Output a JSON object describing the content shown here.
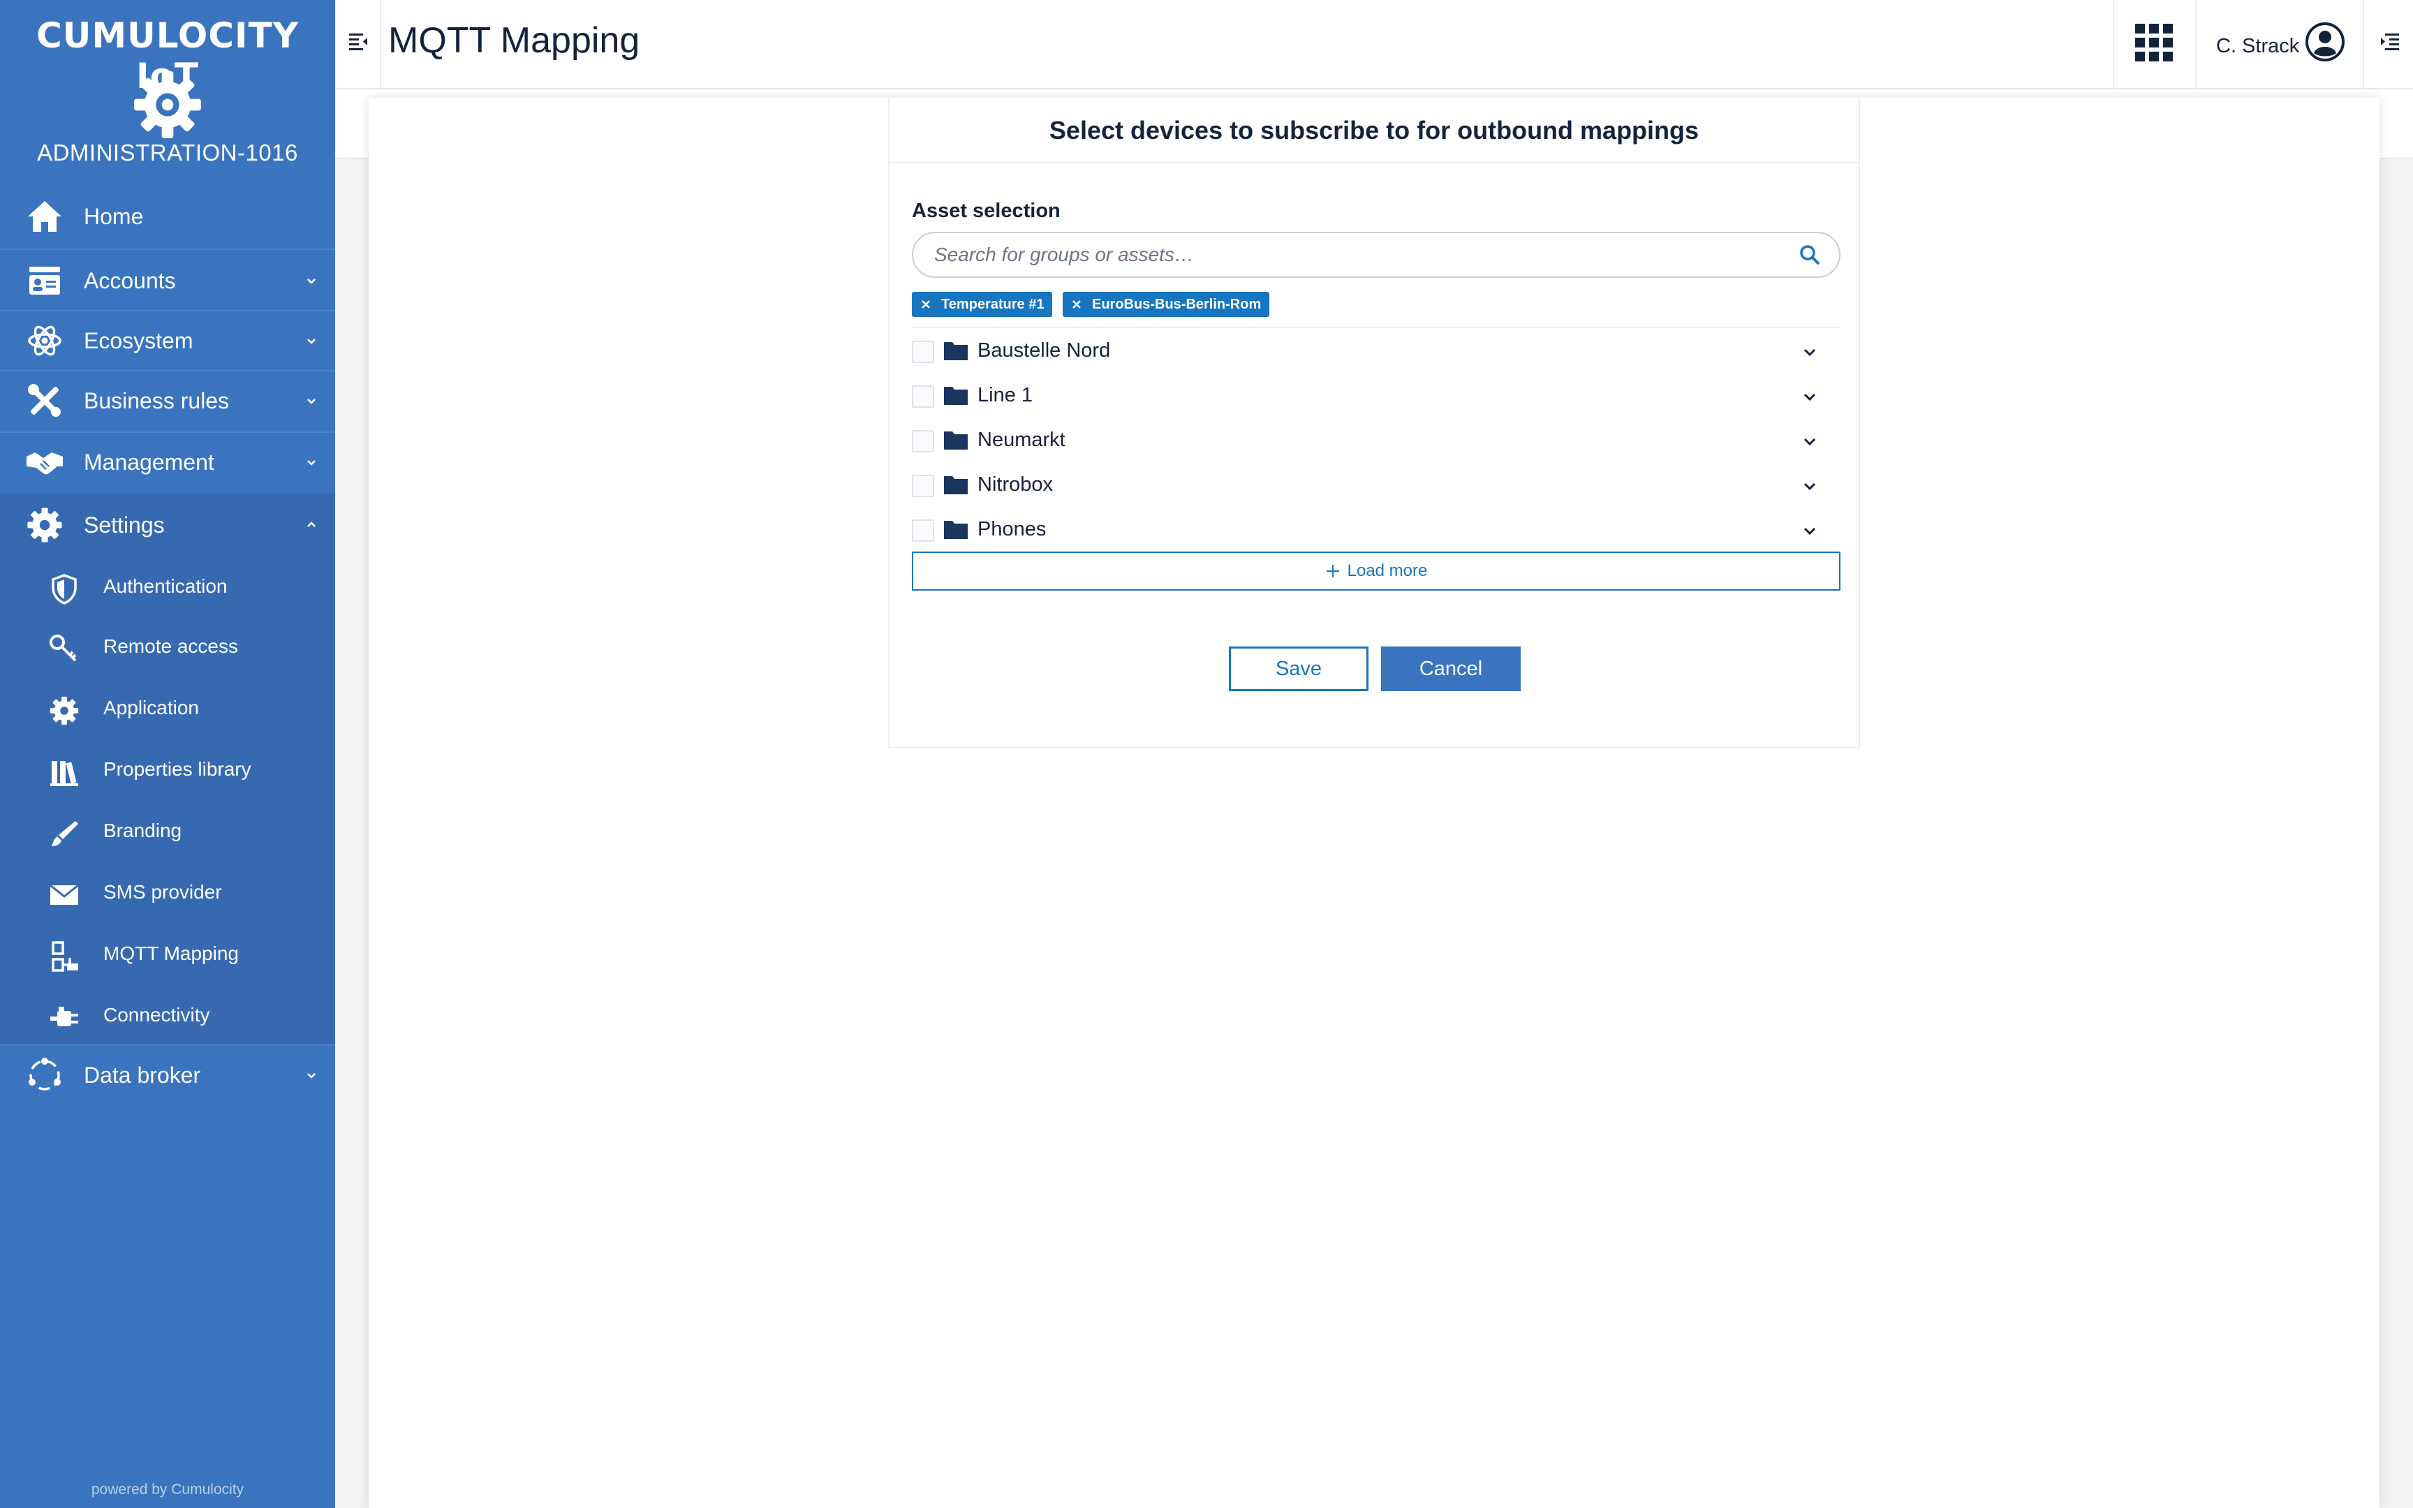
{
  "sidebar": {
    "brand": "CUMULOCITY IoT",
    "tenant": "ADMINISTRATION-1016",
    "items": [
      {
        "label": "Home",
        "icon": "home-icon"
      },
      {
        "label": "Accounts",
        "icon": "accounts-icon"
      },
      {
        "label": "Ecosystem",
        "icon": "atom-icon"
      },
      {
        "label": "Business rules",
        "icon": "tools-icon"
      },
      {
        "label": "Management",
        "icon": "handshake-icon"
      },
      {
        "label": "Settings",
        "icon": "gear-icon"
      },
      {
        "label": "Data broker",
        "icon": "data-broker-icon"
      }
    ],
    "settings_children": [
      {
        "label": "Authentication",
        "icon": "shield-icon"
      },
      {
        "label": "Remote access",
        "icon": "key-icon"
      },
      {
        "label": "Application",
        "icon": "gear-icon"
      },
      {
        "label": "Properties library",
        "icon": "library-icon"
      },
      {
        "label": "Branding",
        "icon": "brush-icon"
      },
      {
        "label": "SMS provider",
        "icon": "envelope-icon"
      },
      {
        "label": "MQTT Mapping",
        "icon": "mapping-icon"
      },
      {
        "label": "Connectivity",
        "icon": "plug-icon"
      }
    ],
    "powered_by": "powered by Cumulocity"
  },
  "header": {
    "title": "MQTT Mapping",
    "user": "C. Strack"
  },
  "modal": {
    "title": "Select devices to subscribe to for outbound mappings",
    "asset_label": "Asset selection",
    "search_placeholder": "Search for groups or assets…",
    "selected_chips": [
      "Temperature #1",
      "EuroBus-Bus-Berlin-Rom"
    ],
    "tree_items": [
      "Baustelle Nord",
      "Line 1",
      "Neumarkt",
      "Nitrobox",
      "Phones"
    ],
    "load_more": "Load more",
    "save": "Save",
    "cancel": "Cancel"
  },
  "colors": {
    "sidebar": "#3a74be",
    "primary": "#1776bf",
    "text": "#14233c"
  }
}
